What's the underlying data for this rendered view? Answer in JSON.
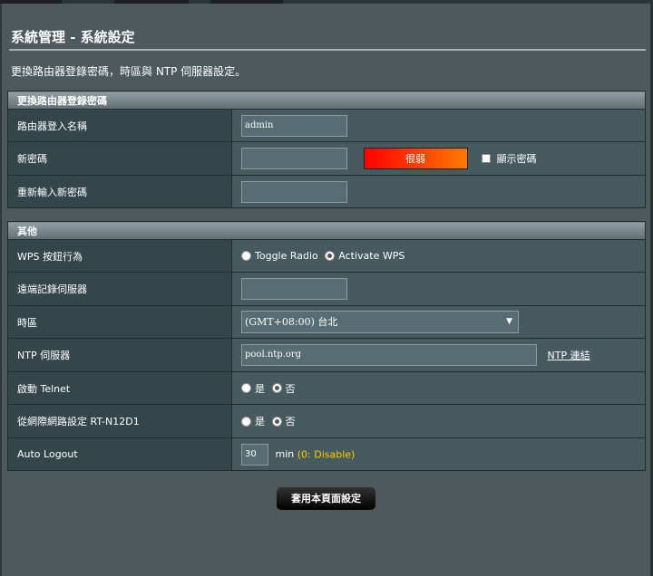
{
  "page": {
    "title": "系統管理 - 系統設定",
    "description": "更換路由器登錄密碼，時區與 NTP 伺服器設定。"
  },
  "password_section": {
    "header": "更換路由器登錄密碼",
    "login_name_label": "路由器登入名稱",
    "login_name_value": "admin",
    "new_password_label": "新密碼",
    "new_password_value": "",
    "strength_text": "很弱",
    "show_password_label": "顯示密碼",
    "show_password_checked": false,
    "retype_label": "重新輸入新密碼",
    "retype_value": ""
  },
  "misc_section": {
    "header": "其他",
    "wps_label": "WPS 按鈕行為",
    "wps_options": [
      "Toggle Radio",
      "Activate WPS"
    ],
    "wps_selected": "Activate WPS",
    "remote_log_label": "遠端記錄伺服器",
    "remote_log_value": "",
    "timezone_label": "時區",
    "timezone_value": "(GMT+08:00) 台北",
    "ntp_label": "NTP 伺服器",
    "ntp_value": "pool.ntp.org",
    "ntp_link": "NTP 連結",
    "telnet_label": "啟動 Telnet",
    "telnet_options": [
      "是",
      "否"
    ],
    "telnet_selected": "否",
    "web_access_label": "從網際網路設定 RT-N12D1",
    "web_access_options": [
      "是",
      "否"
    ],
    "web_access_selected": "否",
    "auto_logout_label": "Auto Logout",
    "auto_logout_value": "30",
    "auto_logout_unit": "min",
    "auto_logout_hint": "(0: Disable)"
  },
  "apply_button": "套用本頁面設定",
  "colors": {
    "background": "#4d595d",
    "row_header": "#35464b",
    "row_cell": "#475a5f",
    "hint": "#ffcc00",
    "strength_start": "#ff0000",
    "strength_end": "#ff7a00"
  }
}
